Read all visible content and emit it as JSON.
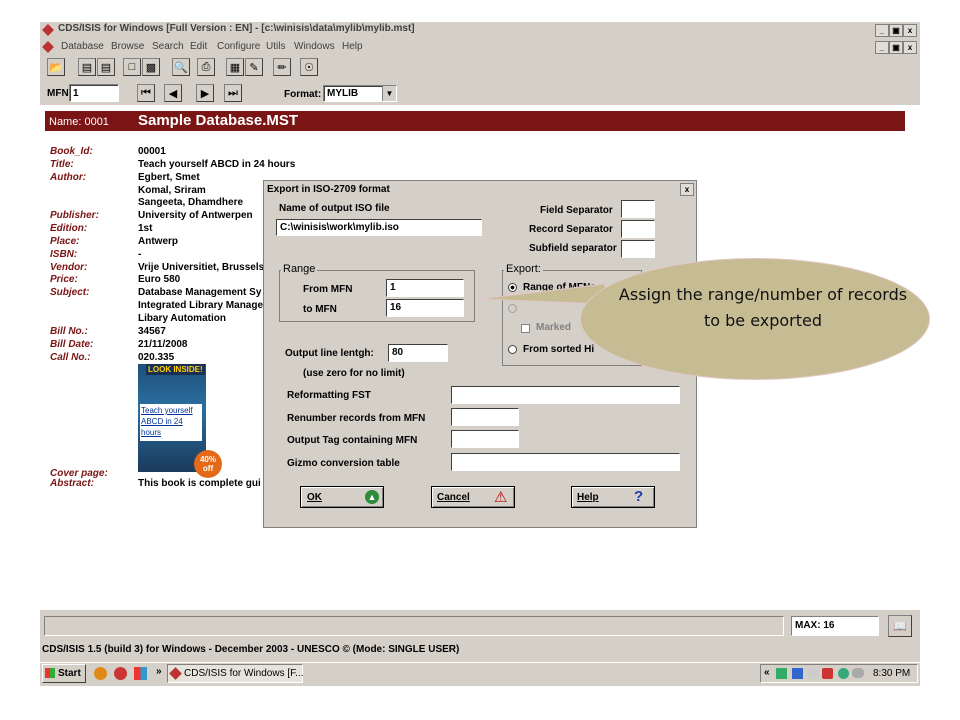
{
  "window": {
    "title": "CDS/ISIS for Windows [Full Version : EN] - [c:\\winisis\\data\\mylib\\mylib.mst]",
    "controls": [
      "_",
      "д",
      "x"
    ]
  },
  "menubar": [
    "Database",
    "Browse",
    "Search",
    "Edit",
    "Configure",
    "Utils",
    "Windows",
    "Help"
  ],
  "navbar": {
    "mfn_label": "MFN",
    "mfn_value": "1",
    "format_label": "Format:",
    "format_value": "MYLIB"
  },
  "record": {
    "name_label": "Name: 0001",
    "db_title": "Sample Database.MST",
    "fields": [
      {
        "label": "Book_Id:",
        "value": "00001"
      },
      {
        "label": "Title:",
        "value": "Teach yourself ABCD in 24 hours"
      },
      {
        "label": "Author:",
        "value": "Egbert, Smet"
      },
      {
        "label": "",
        "value": "Komal, Sriram"
      },
      {
        "label": "",
        "value": "Sangeeta, Dhamdhere"
      },
      {
        "label": "Publisher:",
        "value": "University of Antwerpen"
      },
      {
        "label": "Edition:",
        "value": "1st"
      },
      {
        "label": "Place:",
        "value": "Antwerp"
      },
      {
        "label": "ISBN:",
        "value": "-"
      },
      {
        "label": "Vendor:",
        "value": "Vrije Universitiet, Brussels"
      },
      {
        "label": "Price:",
        "value": "Euro 580"
      },
      {
        "label": "Subject:",
        "value": "Database Management Sy"
      },
      {
        "label": "",
        "value": "Integrated Library Manage"
      },
      {
        "label": "",
        "value": "Libary Automation"
      },
      {
        "label": "Bill No.:",
        "value": "34567"
      },
      {
        "label": "Bill Date:",
        "value": "21/11/2008"
      },
      {
        "label": "Call No.:",
        "value": "020.335"
      }
    ],
    "cover_badge": "LOOK INSIDE!",
    "cover_text": "Teach yourself ABCD in 24 hours",
    "cover_discount": "40% off",
    "cover_label": "Cover page:",
    "abstract_label": "Abstract:",
    "abstract_value": "This book is complete gui"
  },
  "dialog": {
    "title": "Export in ISO-2709 format",
    "close": "x",
    "iso_name_label": "Name of output ISO file",
    "iso_name_value": "C:\\winisis\\work\\mylib.iso",
    "field_sep_label": "Field Separator",
    "record_sep_label": "Record Separator",
    "subfield_sep_label": "Subfield separator",
    "range_title": "Range",
    "from_mfn_label": "From MFN",
    "from_mfn_value": "1",
    "to_mfn_label": "to MFN",
    "to_mfn_value": "16",
    "export_title": "Export:",
    "export_range": "Range of MFNs",
    "export_marked": "Marked",
    "export_sorted": "From sorted Hi",
    "line_length_label": "Output line lentgh:",
    "line_length_value": "80",
    "zero_note": "(use zero for no limit)",
    "reformat_label": "Reformatting FST",
    "renumber_label": "Renumber records from MFN",
    "tag_label": "Output Tag containing MFN",
    "gizmo_label": "Gizmo conversion table",
    "ok": "OK",
    "cancel": "Cancel",
    "help": "Help"
  },
  "callout": {
    "text": "Assign the range/number of records to be exported"
  },
  "status": {
    "max": "MAX: 16",
    "version": "CDS/ISIS 1.5 (build 3) for Windows - December 2003 - UNESCO © (Mode: SINGLE USER)"
  },
  "taskbar": {
    "start": "Start",
    "task": "CDS/ISIS for Windows [F...",
    "clock": "8:30 PM"
  }
}
